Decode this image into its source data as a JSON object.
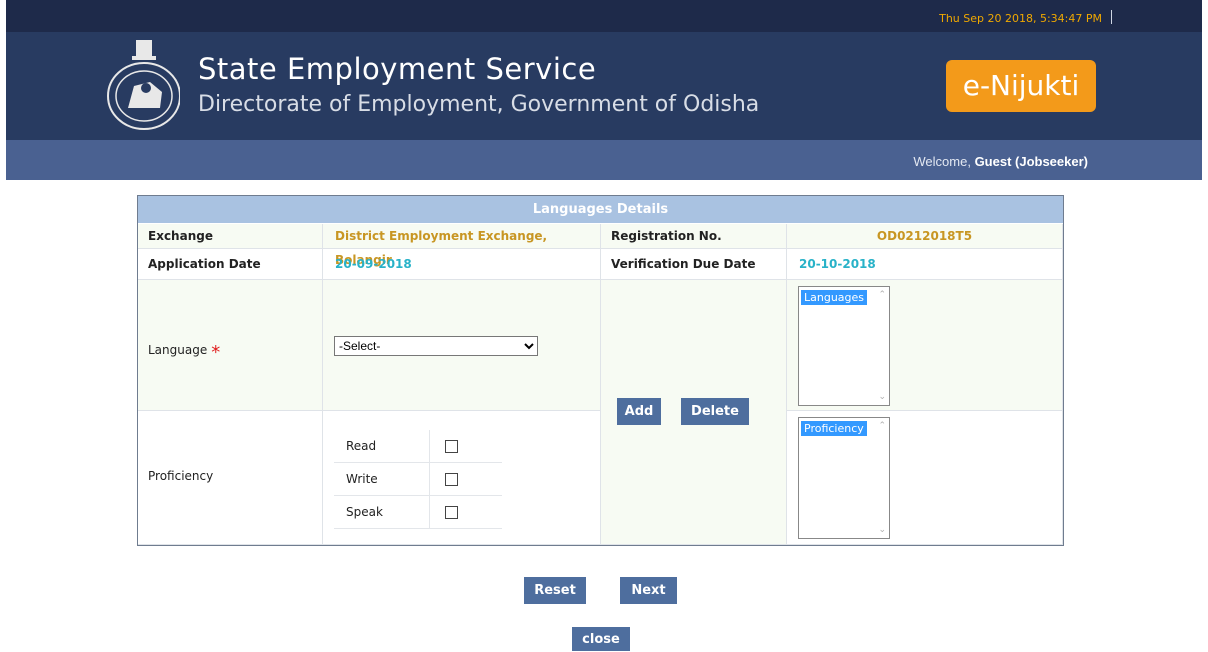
{
  "header": {
    "datetime": "Thu Sep 20 2018, 5:34:47 PM",
    "title": "State Employment Service",
    "subtitle": "Directorate of Employment, Government of Odisha",
    "brand": "e-Nijukti",
    "welcome_prefix": "Welcome,",
    "welcome_user": "Guest (Jobseeker)"
  },
  "panel": {
    "title": "Languages Details",
    "exchange_label": "Exchange",
    "exchange_value": "District Employment Exchange, Bolangir",
    "registration_label": "Registration No.",
    "registration_value": "OD0212018T5",
    "application_date_label": "Application Date",
    "application_date_value": "20-09-2018",
    "verification_label": "Verification Due Date",
    "verification_value": "20-10-2018",
    "language_label": "Language",
    "required_mark": "*",
    "language_select_value": "-Select-",
    "proficiency_label": "Proficiency",
    "proficiency_options": [
      "Read",
      "Write",
      "Speak"
    ],
    "add_button": "Add",
    "delete_button": "Delete",
    "languages_list_item": "Languages",
    "proficiency_list_item": "Proficiency"
  },
  "actions": {
    "reset": "Reset",
    "next": "Next",
    "close": "close"
  },
  "colors": {
    "header_bg": "#283b61",
    "welcome_bar_bg": "#4a6191",
    "brand_orange": "#f39a1a",
    "panel_head_bg": "#a9c2e1",
    "button_bg": "#4e6e9e"
  }
}
